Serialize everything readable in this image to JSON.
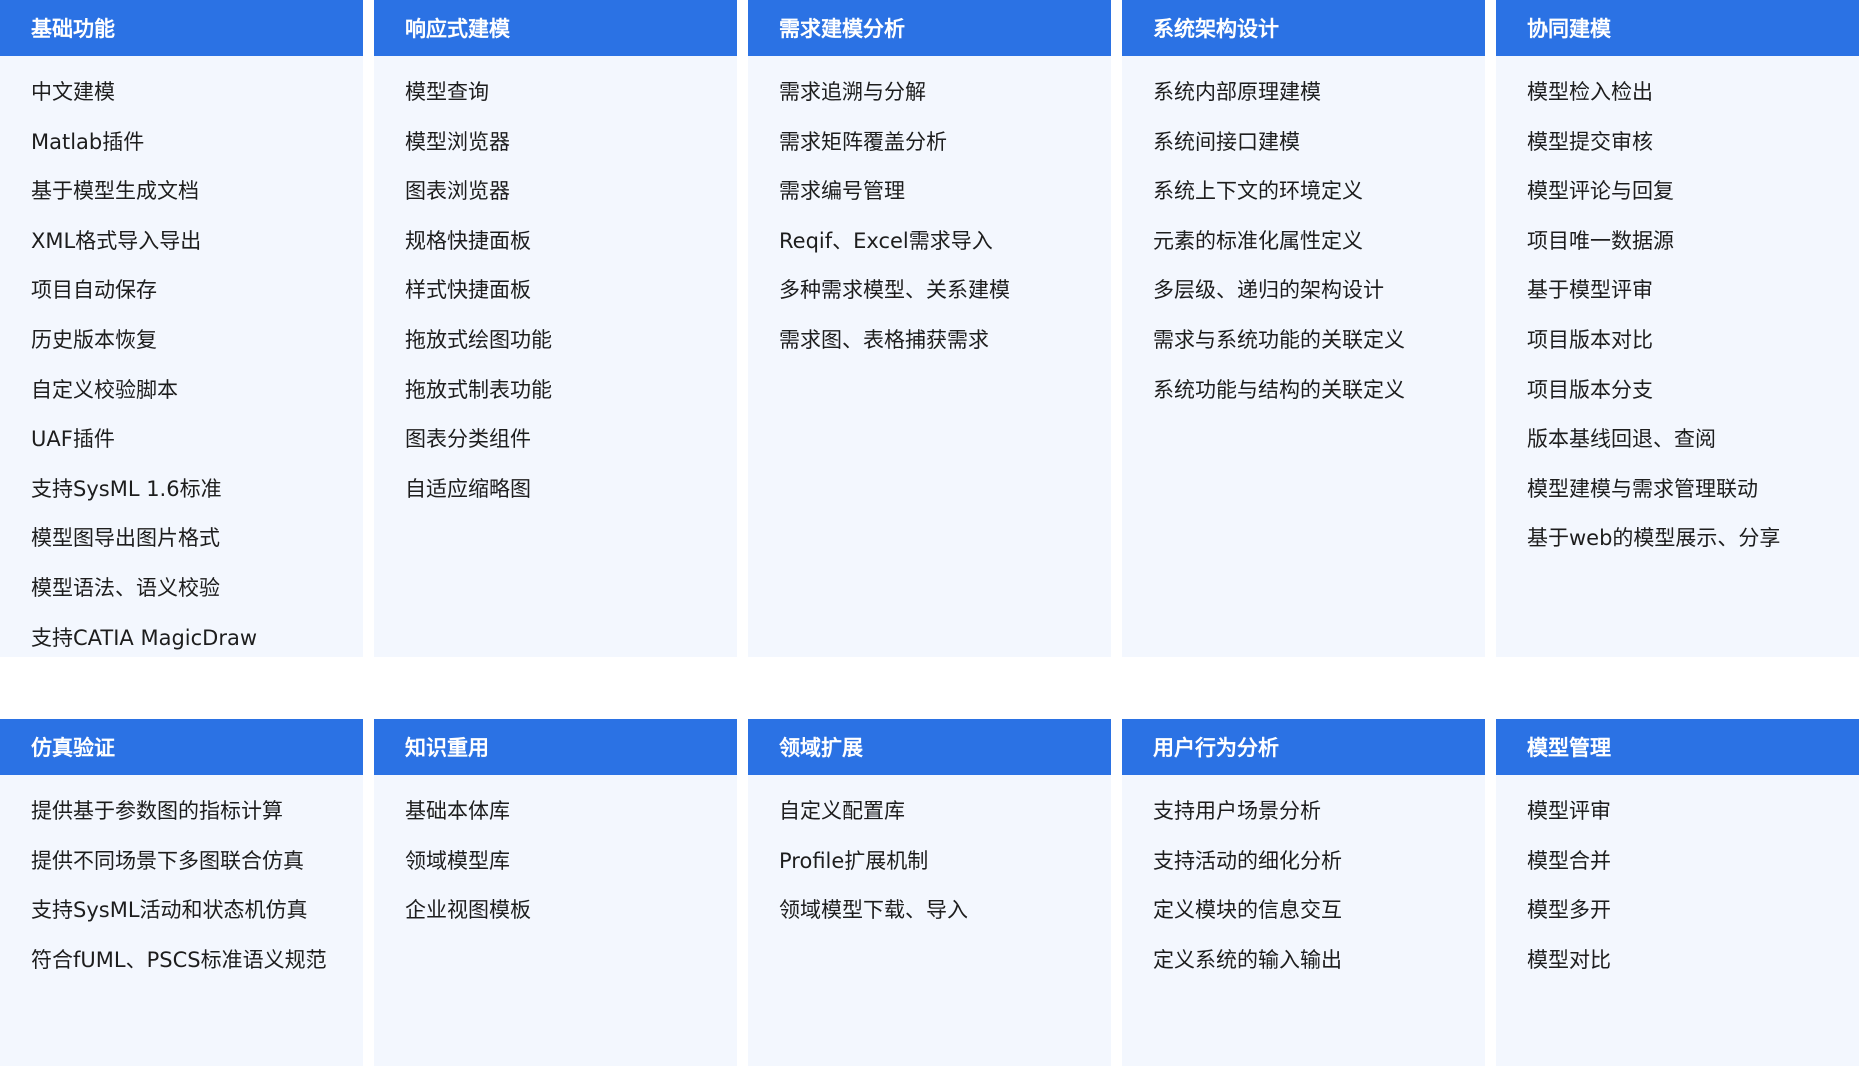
{
  "rows": [
    {
      "panels": [
        {
          "title": "基础功能",
          "items": [
            "中文建模",
            "Matlab插件",
            "基于模型生成文档",
            "XML格式导入导出",
            "项目自动保存",
            "历史版本恢复",
            "自定义校验脚本",
            "UAF插件",
            "支持SysML 1.6标准",
            "模型图导出图片格式",
            "模型语法、语义校验",
            "支持CATIA MagicDraw"
          ]
        },
        {
          "title": "响应式建模",
          "items": [
            "模型查询",
            "模型浏览器",
            "图表浏览器",
            "规格快捷面板",
            "样式快捷面板",
            "拖放式绘图功能",
            "拖放式制表功能",
            "图表分类组件",
            "自适应缩略图"
          ]
        },
        {
          "title": "需求建模分析",
          "items": [
            "需求追溯与分解",
            "需求矩阵覆盖分析",
            "需求编号管理",
            "Reqif、Excel需求导入",
            "多种需求模型、关系建模",
            "需求图、表格捕获需求"
          ]
        },
        {
          "title": "系统架构设计",
          "items": [
            "系统内部原理建模",
            "系统间接口建模",
            "系统上下文的环境定义",
            "元素的标准化属性定义",
            "多层级、递归的架构设计",
            "需求与系统功能的关联定义",
            "系统功能与结构的关联定义"
          ]
        },
        {
          "title": "协同建模",
          "items": [
            "模型检入检出",
            "模型提交审核",
            "模型评论与回复",
            "项目唯一数据源",
            "基于模型评审",
            "项目版本对比",
            "项目版本分支",
            "版本基线回退、查阅",
            "模型建模与需求管理联动",
            "基于web的模型展示、分享"
          ]
        }
      ]
    },
    {
      "panels": [
        {
          "title": "仿真验证",
          "items": [
            "提供基于参数图的指标计算",
            "提供不同场景下多图联合仿真",
            "支持SysML活动和状态机仿真",
            "符合fUML、PSCS标准语义规范"
          ]
        },
        {
          "title": "知识重用",
          "items": [
            "基础本体库",
            "领域模型库",
            "企业视图模板"
          ]
        },
        {
          "title": "领域扩展",
          "items": [
            "自定义配置库",
            "Profile扩展机制",
            "领域模型下载、导入"
          ]
        },
        {
          "title": "用户行为分析",
          "items": [
            "支持用户场景分析",
            "支持活动的细化分析",
            "定义模块的信息交互",
            "定义系统的输入输出"
          ]
        },
        {
          "title": "模型管理",
          "items": [
            "模型评审",
            "模型合并",
            "模型多开",
            "模型对比"
          ]
        }
      ]
    }
  ]
}
